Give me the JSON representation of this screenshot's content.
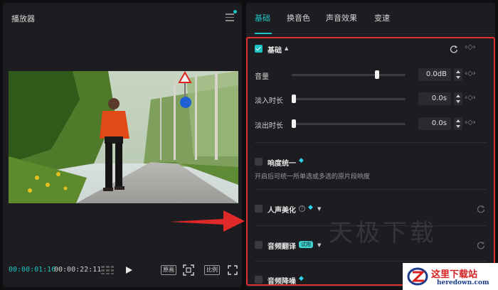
{
  "player": {
    "title": "播放器",
    "current_time": "00:00:01:16",
    "total_time": "00:00:22:11",
    "btn_original": "原画",
    "btn_ratio": "比例"
  },
  "tabs": [
    {
      "label": "基础",
      "active": true
    },
    {
      "label": "换音色",
      "active": false
    },
    {
      "label": "声音效果",
      "active": false
    },
    {
      "label": "变速",
      "active": false
    }
  ],
  "basic": {
    "title": "基础",
    "checked": true,
    "rows": [
      {
        "label": "音量",
        "value": "0.0dB",
        "level": 0.75
      },
      {
        "label": "淡入时长",
        "value": "0.0s",
        "level": 0.0
      },
      {
        "label": "淡出时长",
        "value": "0.0s",
        "level": 0.0
      }
    ]
  },
  "loudness": {
    "title": "响度统一",
    "description": "开启后可统一所单选或多选的原片段响度"
  },
  "voice_beautify": {
    "title": "人声美化"
  },
  "audio_translate": {
    "title": "音频翻译",
    "badge": "试用"
  },
  "denoise": {
    "title": "音频降噪"
  },
  "watermark": "天极下载",
  "logo": {
    "name": "这里下载站",
    "url": "heredown.com"
  },
  "colors": {
    "accent": "#1ec4c4",
    "highlight_box": "#e33030",
    "panel": "#1d1d21"
  },
  "icons": [
    "menu-icon",
    "grid-icon",
    "play-icon",
    "scan-icon",
    "fullscreen-icon",
    "reset-icon",
    "keyframe-icon",
    "diamond-icon",
    "help-icon",
    "chevron-icon"
  ]
}
